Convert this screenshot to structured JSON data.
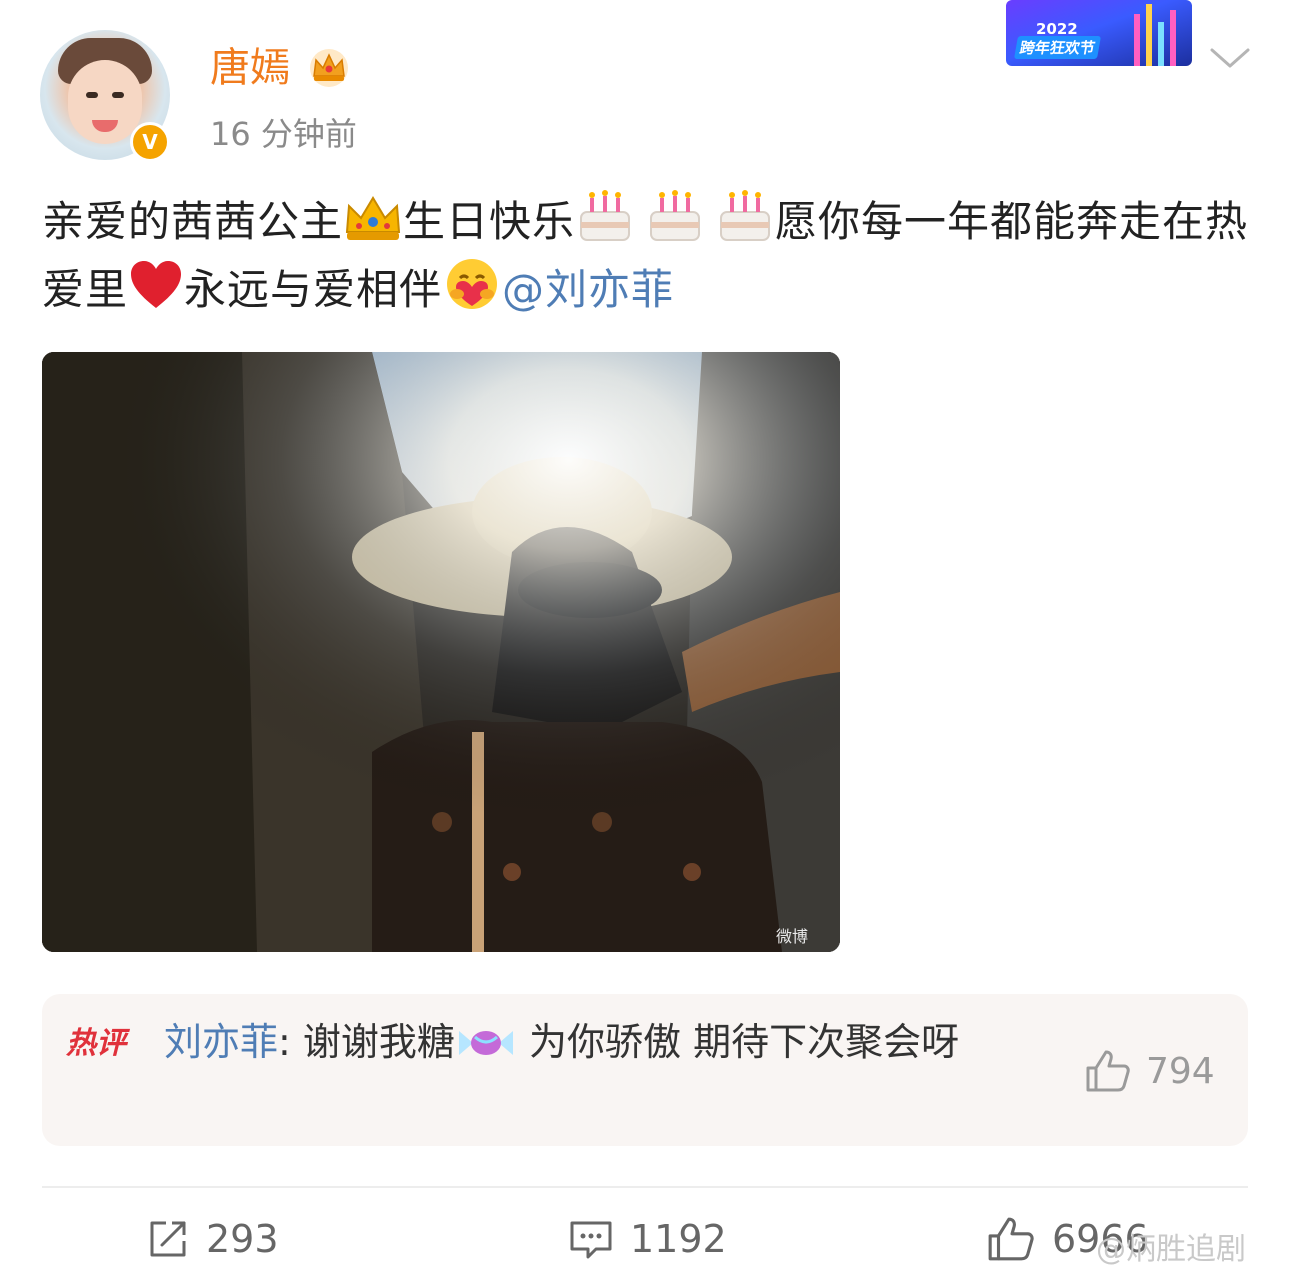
{
  "post": {
    "username": "唐嫣",
    "time": "16 分钟前",
    "verified_mark": "V",
    "text_main": "亲爱的茜茜公主",
    "text_after_crown": "生日快乐",
    "text_after_cakes": "愿你每一年都能奔走在热爱里",
    "text_after_heart": "永远与爱相伴",
    "mention": "@刘亦菲",
    "photo_watermark": "微博"
  },
  "event_badge": {
    "year": "2022",
    "name": "跨年狂欢节"
  },
  "hot_comment": {
    "tag": "热评",
    "user": "刘亦菲",
    "separator": ": ",
    "text_before_candy": "谢谢我糖",
    "text_after_candy": " 为你骄傲 期待下次聚会呀",
    "likes": "794"
  },
  "actions": {
    "reposts": "293",
    "comments": "1192",
    "likes": "6966"
  },
  "watermark": "@炳胜追剧",
  "icons": {
    "verified": "verified-badge-icon",
    "crown": "crown-icon",
    "more": "chevron-down-icon",
    "repost": "repost-icon",
    "comment": "comment-icon",
    "like": "thumbs-up-icon",
    "emoji_crown": "crown-emoji",
    "emoji_cake": "birthday-cake-emoji",
    "emoji_heart": "red-heart-emoji",
    "emoji_hug": "hugging-heart-emoji",
    "emoji_candy": "candy-emoji"
  },
  "colors": {
    "username": "#f07b1d",
    "mention": "#4f7db5",
    "hot_tag": "#e0313b",
    "secondary_text": "#8a8a8a"
  }
}
